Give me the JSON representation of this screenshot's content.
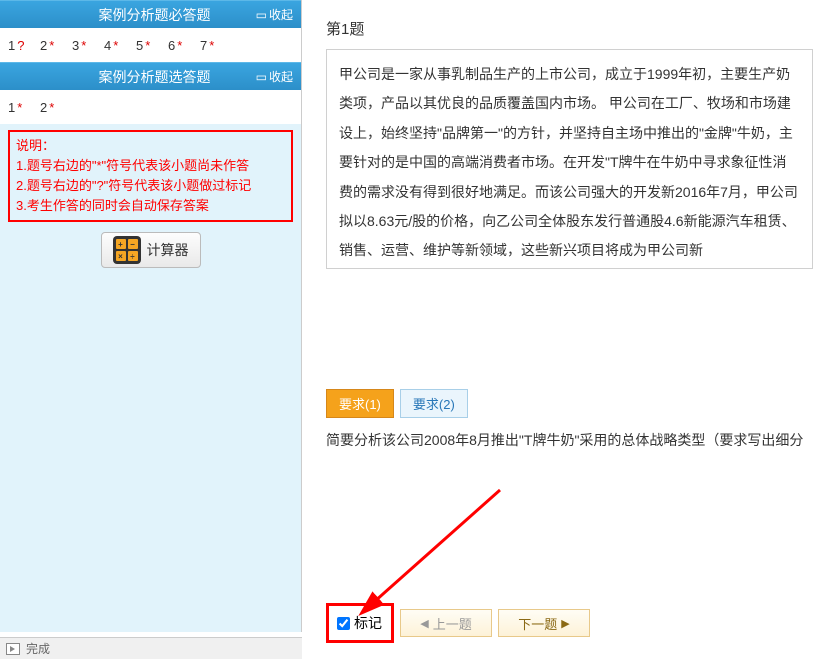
{
  "left": {
    "section1": {
      "title": "案例分析题必答题",
      "collapse": "收起",
      "items": [
        {
          "num": "1",
          "mark": "?"
        },
        {
          "num": "2",
          "mark": "*"
        },
        {
          "num": "3",
          "mark": "*"
        },
        {
          "num": "4",
          "mark": "*"
        },
        {
          "num": "5",
          "mark": "*"
        },
        {
          "num": "6",
          "mark": "*"
        },
        {
          "num": "7",
          "mark": "*"
        }
      ]
    },
    "section2": {
      "title": "案例分析题选答题",
      "collapse": "收起",
      "items": [
        {
          "num": "1",
          "mark": "*"
        },
        {
          "num": "2",
          "mark": "*"
        }
      ]
    },
    "instructions": {
      "heading": "说明：",
      "line1": "1.题号右边的\"*\"符号代表该小题尚未作答",
      "line2": "2.题号右边的\"?\"符号代表该小题做过标记",
      "line3": "3.考生作答的同时会自动保存答案"
    },
    "calculator_label": "计算器"
  },
  "right": {
    "question_title": "第1题",
    "passage": "甲公司是一家从事乳制品生产的上市公司，成立于1999年初，主要生产奶类项，产品以其优良的品质覆盖国内市场。\n甲公司在工厂、牧场和市场建设上，始终坚持\"品牌第一\"的方针，并坚持自主场中推出的\"金牌\"牛奶，主要针对的是中国的高端消费者市场。在开发\"T牌牛在牛奶中寻求象征性消费的需求没有得到很好地满足。而该公司强大的开发新2016年7月，甲公司拟以8.63元/股的价格，向乙公司全体股东发行普通股4.6新能源汽车租赁、销售、运营、维护等新领域，这些新兴项目将成为甲公司新",
    "tabs": [
      {
        "label": "要求(1)",
        "active": true
      },
      {
        "label": "要求(2)",
        "active": false
      }
    ],
    "requirement": "简要分析该公司2008年8月推出\"T牌牛奶\"采用的总体战略类型（要求写出细分",
    "mark_label": "标记",
    "prev_btn": "上一题",
    "next_btn": "下一题"
  },
  "status": {
    "done": "完成"
  }
}
